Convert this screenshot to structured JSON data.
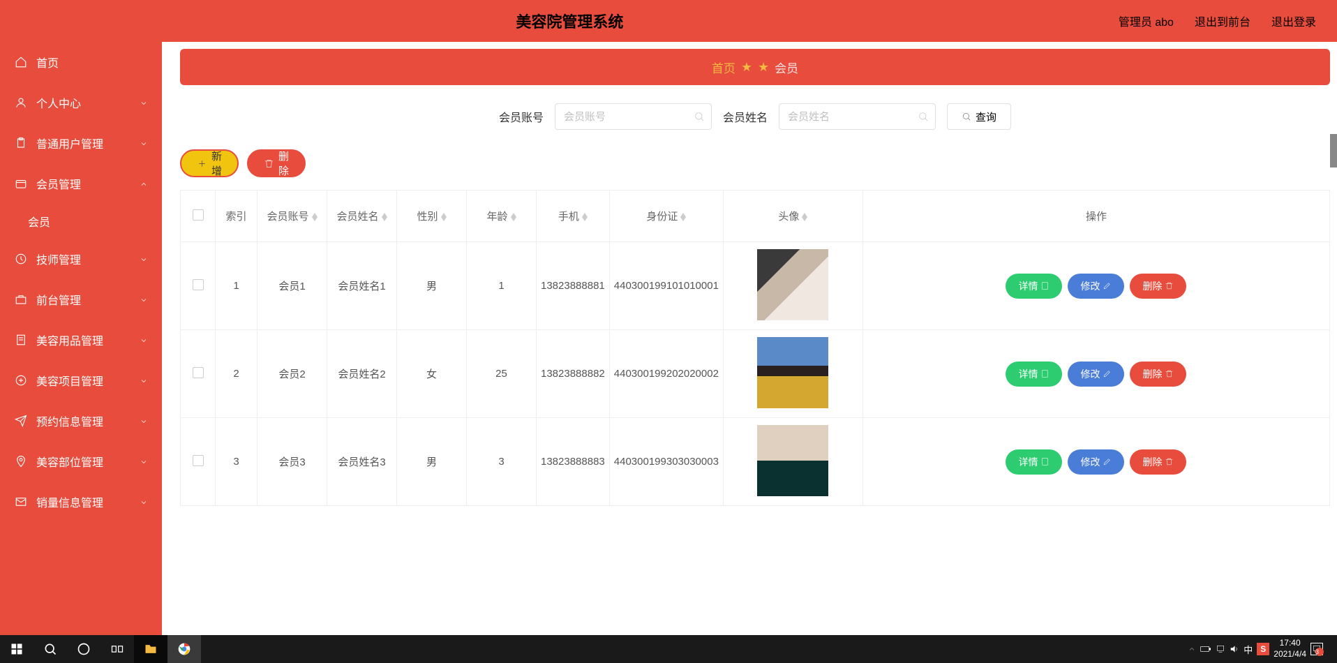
{
  "header": {
    "title": "美容院管理系统",
    "user_label": "管理员 abo",
    "link_front": "退出到前台",
    "link_logout": "退出登录"
  },
  "sidebar": {
    "items": [
      {
        "icon": "home",
        "label": "首页",
        "chevron": null
      },
      {
        "icon": "user",
        "label": "个人中心",
        "chevron": "down"
      },
      {
        "icon": "clipboard",
        "label": "普通用户管理",
        "chevron": "down"
      },
      {
        "icon": "wallet",
        "label": "会员管理",
        "chevron": "up"
      },
      {
        "icon": null,
        "label": "会员",
        "sub": true
      },
      {
        "icon": "clock",
        "label": "技师管理",
        "chevron": "down"
      },
      {
        "icon": "briefcase",
        "label": "前台管理",
        "chevron": "down"
      },
      {
        "icon": "doc",
        "label": "美容用品管理",
        "chevron": "down"
      },
      {
        "icon": "plus-circle",
        "label": "美容项目管理",
        "chevron": "down"
      },
      {
        "icon": "send",
        "label": "预约信息管理",
        "chevron": "down"
      },
      {
        "icon": "location",
        "label": "美容部位管理",
        "chevron": "down"
      },
      {
        "icon": "mail",
        "label": "销量信息管理",
        "chevron": "down"
      }
    ]
  },
  "breadcrumb": {
    "home": "首页",
    "current": "会员"
  },
  "search": {
    "account_label": "会员账号",
    "account_placeholder": "会员账号",
    "name_label": "会员姓名",
    "name_placeholder": "会员姓名",
    "query_label": "查询"
  },
  "actions": {
    "add_label": "新增",
    "delete_label": "删除"
  },
  "table": {
    "headers": [
      "索引",
      "会员账号",
      "会员姓名",
      "性别",
      "年龄",
      "手机",
      "身份证",
      "头像",
      "操作"
    ],
    "row_actions": {
      "detail": "详情",
      "edit": "修改",
      "delete": "删除"
    },
    "rows": [
      {
        "index": "1",
        "account": "会员1",
        "name": "会员姓名1",
        "gender": "男",
        "age": "1",
        "phone": "13823888881",
        "idcard": "440300199101010001"
      },
      {
        "index": "2",
        "account": "会员2",
        "name": "会员姓名2",
        "gender": "女",
        "age": "25",
        "phone": "13823888882",
        "idcard": "440300199202020002"
      },
      {
        "index": "3",
        "account": "会员3",
        "name": "会员姓名3",
        "gender": "男",
        "age": "3",
        "phone": "13823888883",
        "idcard": "440300199303030003"
      }
    ]
  },
  "taskbar": {
    "time": "17:40",
    "date": "2021/4/4",
    "ime": "中",
    "badge": "3"
  }
}
